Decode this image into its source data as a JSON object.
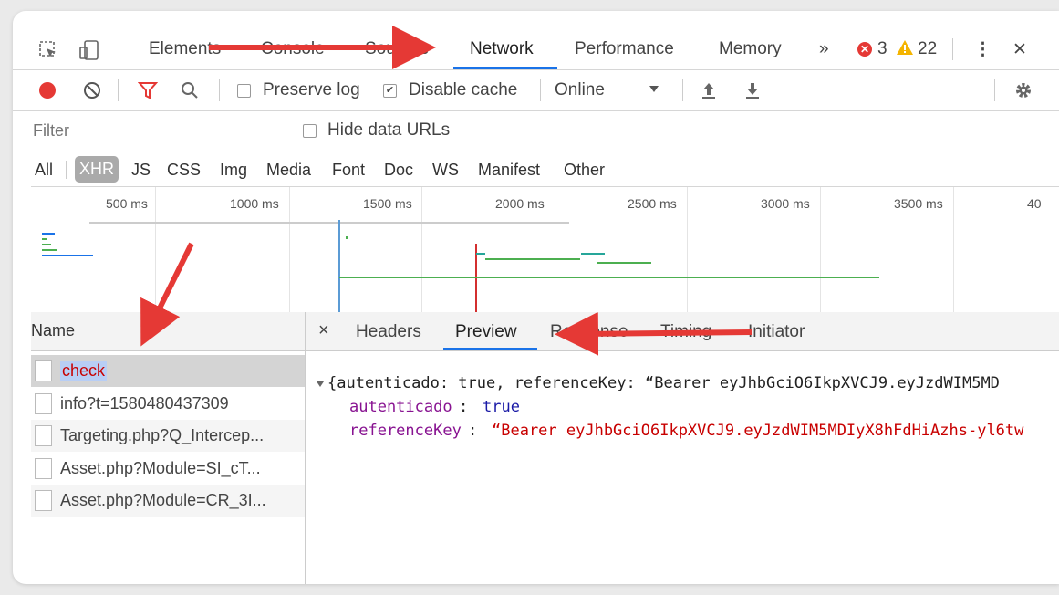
{
  "toolbar": {
    "tabs": [
      "Elements",
      "Console",
      "Sources",
      "Network",
      "Performance",
      "Memory"
    ],
    "more": "»",
    "errors": "3",
    "warnings": "22",
    "menu": "⋮",
    "close": "✕"
  },
  "network_toolbar": {
    "preserve_log": "Preserve log",
    "disable_cache": "Disable cache",
    "throttle": "Online"
  },
  "filter_bar": {
    "placeholder": "Filter",
    "hide_data_urls": "Hide data URLs",
    "types": [
      "All",
      "XHR",
      "JS",
      "CSS",
      "Img",
      "Media",
      "Font",
      "Doc",
      "WS",
      "Manifest",
      "Other"
    ]
  },
  "overview": {
    "ticks": [
      "500 ms",
      "1000 ms",
      "1500 ms",
      "2000 ms",
      "2500 ms",
      "3000 ms",
      "3500 ms",
      "40"
    ]
  },
  "requests": {
    "header": "Name",
    "items": [
      "check",
      "info?t=1580480437309",
      "Targeting.php?Q_Intercep...",
      "Asset.php?Module=SI_cT...",
      "Asset.php?Module=CR_3I..."
    ]
  },
  "details": {
    "close": "×",
    "tabs": [
      "Headers",
      "Preview",
      "Response",
      "Timing",
      "Initiator"
    ],
    "preview": {
      "summary": "{autenticado: true, referenceKey: “Bearer eyJhbGciO6IkpXVCJ9.eyJzdWIM5MD",
      "key1": "autenticado",
      "val1": "true",
      "key2": "referenceKey",
      "val2": "“Bearer eyJhbGciO6IkpXVCJ9.eyJzdWIM5MDIyX8hFdHiAzhs-yl6tw"
    }
  },
  "colors": {
    "accent": "#1a73e8",
    "record": "#e53935",
    "string": "#c80000",
    "key": "#881391",
    "arrow": "#e53935"
  }
}
